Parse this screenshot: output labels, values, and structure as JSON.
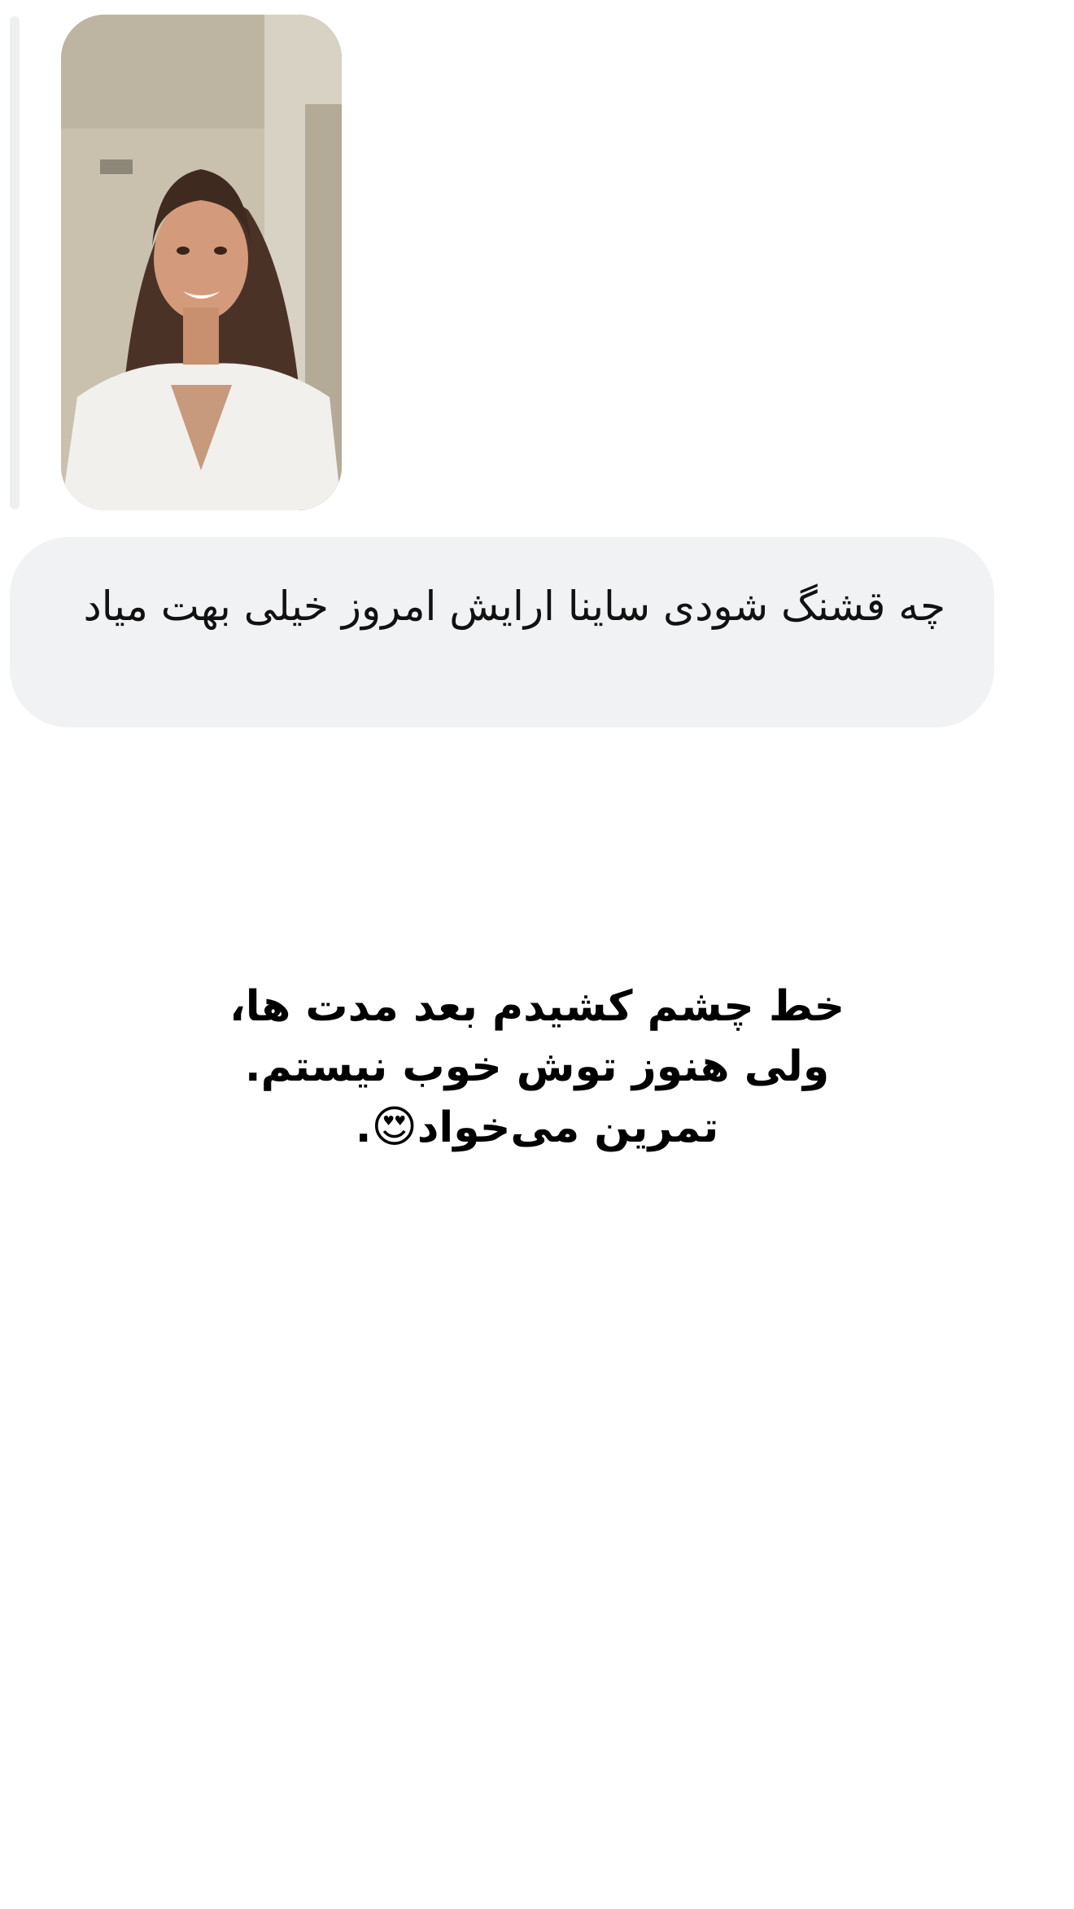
{
  "message": {
    "text": "چه قشنگ شودی ساینا ارایش امروز خیلی بهت میاد"
  },
  "caption": {
    "line1": "خط چشم کشیدم بعد مدت ها،",
    "line2": "ولی هنوز توش خوب نیستم.",
    "line3_text": "تمرین می‌خواد",
    "line3_emoji": "😍",
    "line3_end": "."
  },
  "colors": {
    "bubble": "#f1f2f4",
    "reply_bar": "#eeeff1",
    "text": "#111111"
  }
}
